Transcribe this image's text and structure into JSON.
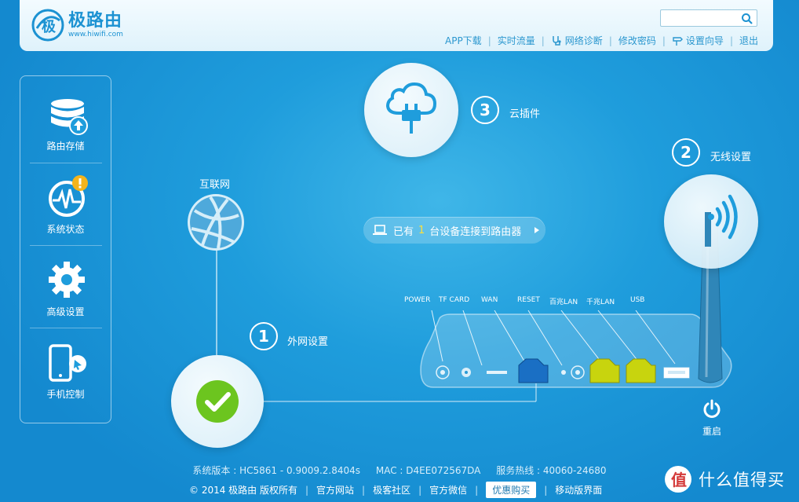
{
  "brand": {
    "name": "极路由",
    "url": "www.hiwifi.com"
  },
  "search": {
    "placeholder": ""
  },
  "topnav": [
    {
      "label": "APP下载",
      "icon": ""
    },
    {
      "label": "实时流量",
      "icon": ""
    },
    {
      "label": "网络诊断",
      "icon": "stethoscope-icon"
    },
    {
      "label": "修改密码",
      "icon": ""
    },
    {
      "label": "设置向导",
      "icon": "signpost-icon"
    },
    {
      "label": "退出",
      "icon": ""
    }
  ],
  "sidebar": {
    "items": [
      {
        "label": "路由存储",
        "icon": "storage-icon"
      },
      {
        "label": "系统状态",
        "icon": "status-icon"
      },
      {
        "label": "高级设置",
        "icon": "gear-icon"
      },
      {
        "label": "手机控制",
        "icon": "phone-icon"
      }
    ]
  },
  "steps": {
    "internet_label": "互联网",
    "step1": {
      "num": "1",
      "label": "外网设置"
    },
    "step2": {
      "num": "2",
      "label": "无线设置"
    },
    "step3": {
      "num": "3",
      "label": "云插件"
    }
  },
  "devices": {
    "prefix": "已有",
    "count": "1",
    "suffix": "台设备连接到路由器"
  },
  "ports": [
    "POWER",
    "TF CARD",
    "WAN",
    "RESET",
    "百兆LAN",
    "千兆LAN",
    "USB"
  ],
  "reboot_label": "重启",
  "footer": {
    "version": "系统版本 : HC5861 - 0.9009.2.8404s",
    "mac": "MAC : D4EE072567DA",
    "hotline": "服务热线 : 40060-24680",
    "links": [
      "© 2014 极路由 版权所有",
      "官方网站",
      "极客社区",
      "官方微信",
      "优惠购买",
      "移动版界面"
    ]
  },
  "watermark": "什么值得买",
  "colors": {
    "accent": "#1c92d2",
    "highlight": "#ffe03a",
    "ok": "#6cc51f",
    "lan": "#c8d40e",
    "wan": "#1a6fc4"
  }
}
